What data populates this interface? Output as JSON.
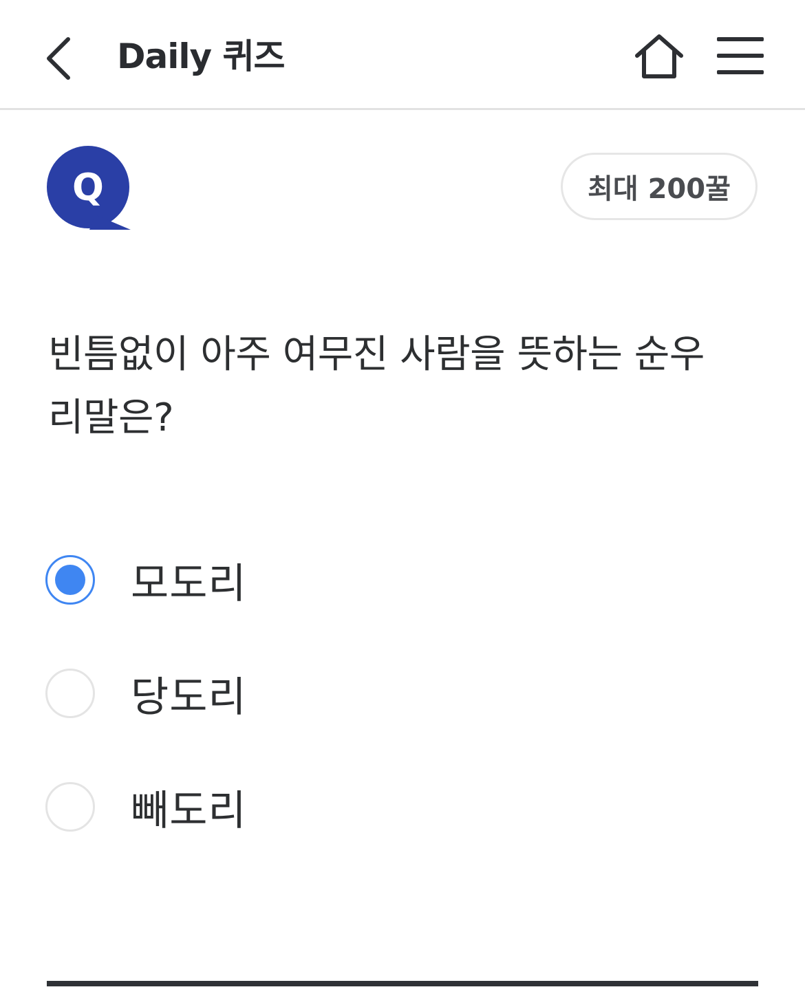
{
  "header": {
    "title": "Daily 퀴즈",
    "back_icon": "chevron-left-icon",
    "home_icon": "home-icon",
    "menu_icon": "hamburger-menu-icon"
  },
  "quiz": {
    "badge_letter": "Q",
    "badge_color": "#2a3fa6",
    "reward": "최대 200꿀",
    "question_line1": "빈틈없이 아주 여무진 사람을 뜻하는 순우",
    "question_line2": "리말은?",
    "options": [
      {
        "label": "모도리",
        "selected": true
      },
      {
        "label": "당도리",
        "selected": false
      },
      {
        "label": "빼도리",
        "selected": false
      }
    ],
    "accent_color": "#3f86f2"
  }
}
